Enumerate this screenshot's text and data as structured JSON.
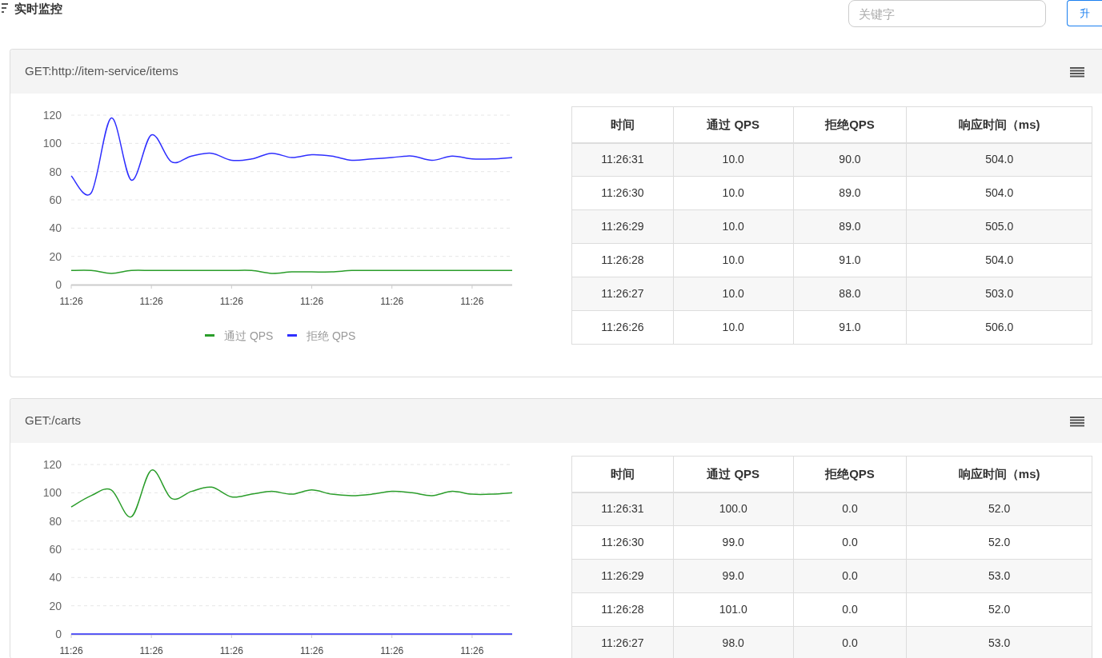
{
  "page": {
    "title": "实时监控",
    "search": {
      "placeholder": "关键字"
    },
    "sort_button": "升"
  },
  "cards": [
    {
      "title": "GET:http://item-service/items",
      "chart_data": {
        "type": "line",
        "grid": true,
        "legend": true,
        "categories": [
          "11:26",
          null,
          null,
          null,
          "11:26",
          null,
          null,
          null,
          "11:26",
          null,
          null,
          null,
          "11:26",
          null,
          null,
          null,
          "11:26",
          null,
          null,
          null,
          "11:26",
          null,
          null
        ],
        "ylim": [
          0,
          120
        ],
        "yticks": [
          0,
          20,
          40,
          60,
          80,
          100,
          120
        ],
        "series": [
          {
            "name": "通过 QPS",
            "color": "#2a9d2a",
            "values": [
              10,
              10,
              8,
              10,
              10,
              10,
              10,
              10,
              10,
              10,
              8,
              9,
              9,
              9,
              10,
              10,
              10,
              10,
              10,
              10,
              10,
              10,
              10
            ]
          },
          {
            "name": "拒绝 QPS",
            "color": "#2f2fff",
            "values": [
              77,
              65,
              118,
              74,
              106,
              87,
              91,
              93,
              88,
              89,
              93,
              90,
              92,
              91,
              88,
              89,
              90,
              91,
              88,
              91,
              89,
              89,
              90
            ]
          }
        ]
      },
      "table": {
        "columns": [
          "时间",
          "通过 QPS",
          "拒绝QPS",
          "响应时间（ms)"
        ],
        "rows": [
          [
            "11:26:31",
            "10.0",
            "90.0",
            "504.0"
          ],
          [
            "11:26:30",
            "10.0",
            "89.0",
            "504.0"
          ],
          [
            "11:26:29",
            "10.0",
            "89.0",
            "505.0"
          ],
          [
            "11:26:28",
            "10.0",
            "91.0",
            "504.0"
          ],
          [
            "11:26:27",
            "10.0",
            "88.0",
            "503.0"
          ],
          [
            "11:26:26",
            "10.0",
            "91.0",
            "506.0"
          ]
        ]
      }
    },
    {
      "title": "GET:/carts",
      "chart_data": {
        "type": "line",
        "grid": true,
        "categories": [
          "11:26",
          null,
          null,
          null,
          "11:26",
          null,
          null,
          null,
          "11:26",
          null,
          null,
          null,
          "11:26",
          null,
          null,
          null,
          "11:26",
          null,
          null,
          null,
          "11:26",
          null,
          null
        ],
        "ylim": [
          0,
          120
        ],
        "yticks": [
          0,
          20,
          40,
          60,
          80,
          100,
          120
        ],
        "series": [
          {
            "color": "#2a9d2a",
            "values": [
              90,
              98,
              102,
              83,
              116,
              96,
              101,
              104,
              97,
              99,
              101,
              99,
              102,
              99,
              98,
              99,
              101,
              100,
              98,
              101,
              99,
              99,
              100
            ]
          },
          {
            "color": "#2f2fff",
            "values": [
              0,
              0,
              0,
              0,
              0,
              0,
              0,
              0,
              0,
              0,
              0,
              0,
              0,
              0,
              0,
              0,
              0,
              0,
              0,
              0,
              0,
              0,
              0
            ]
          }
        ]
      },
      "table": {
        "columns": [
          "时间",
          "通过 QPS",
          "拒绝QPS",
          "响应时间（ms)"
        ],
        "rows": [
          [
            "11:26:31",
            "100.0",
            "0.0",
            "52.0"
          ],
          [
            "11:26:30",
            "99.0",
            "0.0",
            "52.0"
          ],
          [
            "11:26:29",
            "99.0",
            "0.0",
            "53.0"
          ],
          [
            "11:26:28",
            "101.0",
            "0.0",
            "52.0"
          ],
          [
            "11:26:27",
            "98.0",
            "0.0",
            "53.0"
          ]
        ]
      }
    }
  ]
}
